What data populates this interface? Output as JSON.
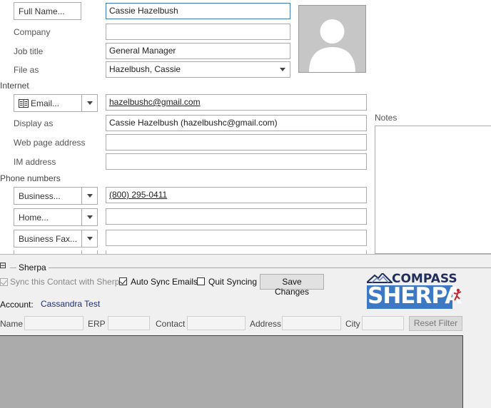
{
  "contact": {
    "full_name_button": "Full Name...",
    "full_name_value": "Cassie Hazelbush",
    "company_label": "Company",
    "company_value": "",
    "job_title_label": "Job title",
    "job_title_value": "General Manager",
    "file_as_label": "File as",
    "file_as_value": "Hazelbush, Cassie"
  },
  "internet": {
    "section_label": "Internet",
    "email_button": "Email...",
    "email_value": "hazelbushc@gmail.com",
    "display_as_label": "Display as",
    "display_as_value": "Cassie Hazelbush (hazelbushc@gmail.com)",
    "web_page_label": "Web page address",
    "web_page_value": "",
    "im_label": "IM address",
    "im_value": ""
  },
  "phone": {
    "section_label": "Phone numbers",
    "items": [
      {
        "label": "Business...",
        "value": "(800) 295-0411"
      },
      {
        "label": "Home...",
        "value": ""
      },
      {
        "label": "Business Fax...",
        "value": ""
      }
    ]
  },
  "notes": {
    "label": "Notes"
  },
  "sherpa": {
    "collapse_glyph": "⊟",
    "section_label": "Sherpa",
    "sync_label": "Sync this Contact with Sherpa",
    "sync_checked": true,
    "auto_sync_label": "Auto Sync Emails",
    "auto_sync_checked": true,
    "quit_label": "Quit Syncing",
    "quit_checked": false,
    "save_label": "Save Changes",
    "account_label": "Account:",
    "account_value": "Cassandra Test",
    "logo_top": "COMPASS",
    "logo_bottom": "SHERPA",
    "filters": {
      "name_label": "Name",
      "erp_label": "ERP",
      "contact_label": "Contact",
      "address_label": "Address",
      "city_label": "City",
      "reset_label": "Reset Filter"
    },
    "brand_colors": {
      "navy": "#1f2e5c",
      "blue": "#3d78c4",
      "red": "#c8222a"
    }
  }
}
